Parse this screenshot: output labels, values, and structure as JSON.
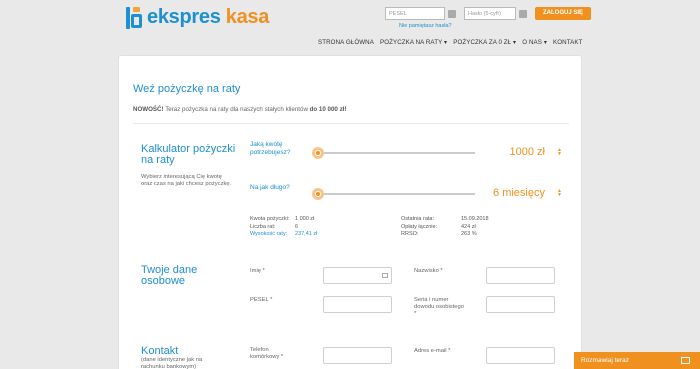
{
  "header": {
    "logo_part1": "ekspres",
    "logo_part2": "kasa",
    "login": {
      "pesel_placeholder": "PESEL",
      "password_placeholder": "Hasło (5-cyfr)",
      "login_button": "ZALOGUJ SIĘ",
      "forgot_link": "Nie pamiętasz hasła?"
    },
    "nav": [
      "STRONA GŁÓWNA",
      "POŻYCZKA NA RATY ▾",
      "POŻYCZKA ZA 0 ZŁ ▾",
      "O NAS ▾",
      "KONTAKT"
    ]
  },
  "main": {
    "title": "Weź pożyczkę na raty",
    "news_bold": "NOWOŚĆ!",
    "news_text": " Teraz pożyczka na raty dla naszych stałych klientów ",
    "news_amount": "do 10 000 zł!",
    "calculator": {
      "title": "Kalkulator pożyczki na raty",
      "description": "Wybierz interesującą Cię kwotę oraz czas na jaki chcesz pożyczkę.",
      "amount_question": "Jaką kwotę potrzebujesz?",
      "amount_value": "1000 zł",
      "amount_fraction": 0.02,
      "term_question": "Na jak długo?",
      "term_value": "6 miesięcy",
      "term_fraction": 0.02,
      "summary_left": [
        {
          "label": "Kwota pożyczki:",
          "value": "1 000 zł"
        },
        {
          "label": "Liczba rat:",
          "value": "6"
        },
        {
          "label": "Wysokość raty:",
          "value": "237,41 zł"
        }
      ],
      "summary_right": [
        {
          "label": "Ostatnia rata:",
          "value": "15.09.2018"
        },
        {
          "label": "Opłaty łącznie:",
          "value": "424 zł"
        },
        {
          "label": "RRSO:",
          "value": "263 %"
        }
      ]
    },
    "personal": {
      "title": "Twoje dane osobowe",
      "first_name_label": "Imię *",
      "last_name_label": "Nazwisko *",
      "pesel_label": "PESEL *",
      "id_label": "Seria i numer dowodu osobistego *"
    },
    "contact": {
      "title": "Kontakt",
      "description": "(dane identyczne jak na rachunku bankowym)",
      "phone_label": "Telefon komórkowy *",
      "email_label": "Adres e-mail *"
    }
  },
  "chat": {
    "label": "Rozmawiaj teraz"
  },
  "colors": {
    "blue": "#1e8fd0",
    "orange": "#f0911f"
  }
}
